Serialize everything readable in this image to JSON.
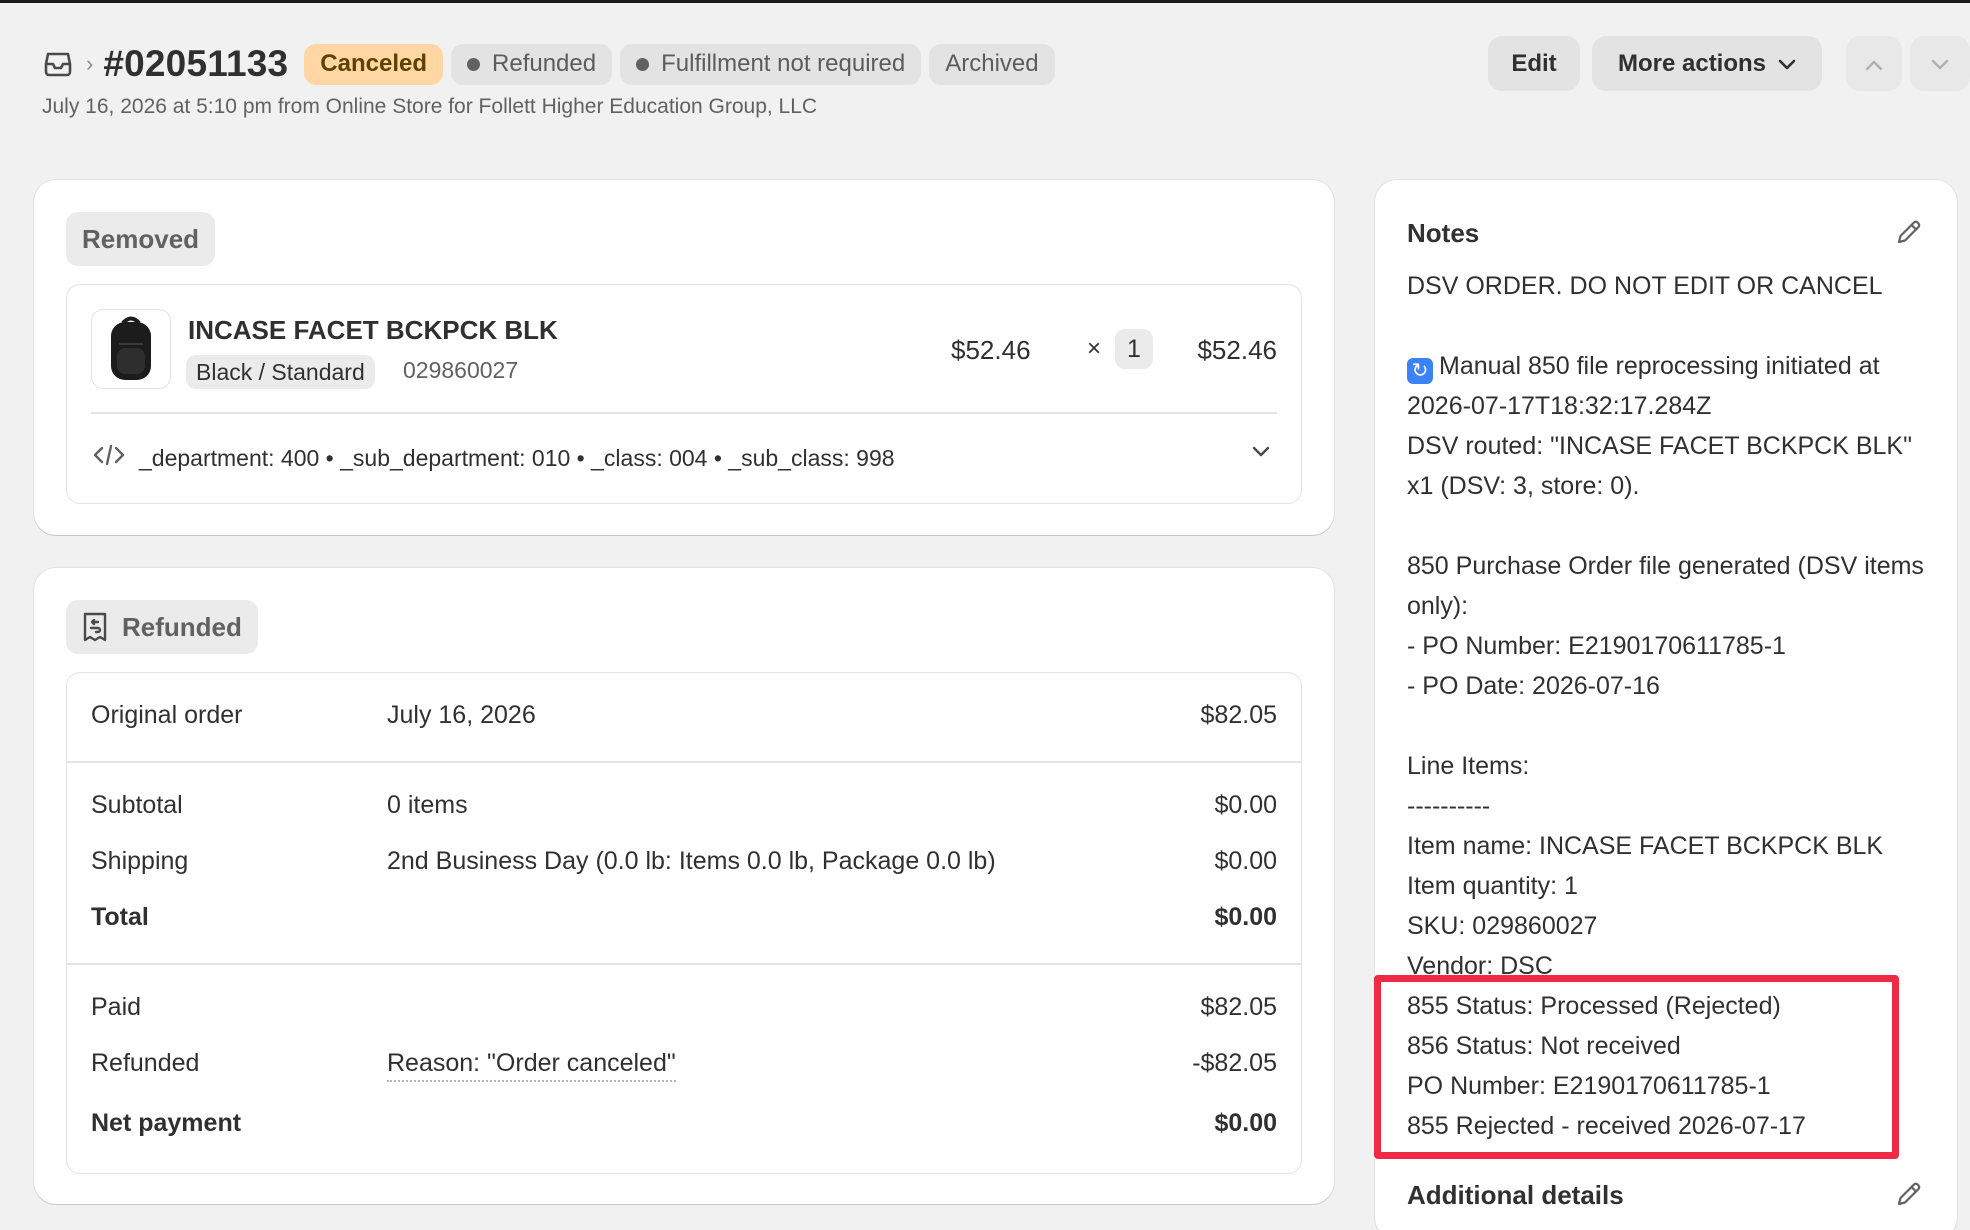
{
  "header": {
    "order_number": "#02051133",
    "badges": {
      "canceled": "Canceled",
      "refunded": "Refunded",
      "fulfillment": "Fulfillment not required",
      "archived": "Archived"
    },
    "subline": "July 16, 2026 at 5:10 pm from Online Store for Follett Higher Education Group, LLC",
    "edit_label": "Edit",
    "more_actions_label": "More actions"
  },
  "removed": {
    "label": "Removed",
    "product": {
      "name": "INCASE FACET BCKPCK BLK",
      "variant": "Black / Standard",
      "sku": "029860027",
      "unit_price": "$52.46",
      "times": "×",
      "quantity": "1",
      "total": "$52.46"
    },
    "attributes": "_department: 400 • _sub_department: 010 • _class: 004 • _sub_class: 998"
  },
  "refunded": {
    "label": "Refunded",
    "original_order": {
      "label": "Original order",
      "date": "July 16, 2026",
      "amount": "$82.05"
    },
    "subtotal": {
      "label": "Subtotal",
      "detail": "0 items",
      "amount": "$0.00"
    },
    "shipping": {
      "label": "Shipping",
      "detail": "2nd Business Day (0.0 lb: Items 0.0 lb, Package 0.0 lb)",
      "amount": "$0.00"
    },
    "total": {
      "label": "Total",
      "amount": "$0.00"
    },
    "paid": {
      "label": "Paid",
      "amount": "$82.05"
    },
    "refund": {
      "label": "Refunded",
      "reason": "Reason: \"Order canceled\"",
      "amount": "-$82.05"
    },
    "net_payment": {
      "label": "Net payment",
      "amount": "$0.00"
    }
  },
  "notes": {
    "title": "Notes",
    "lines": [
      "DSV ORDER. DO NOT EDIT OR CANCEL",
      "",
      "Manual 850 file reprocessing initiated at 2026-07-17T18:32:17.284Z",
      "DSV routed: \"INCASE FACET BCKPCK BLK\" x1 (DSV: 3, store: 0).",
      "",
      "850 Purchase Order file generated (DSV items only):",
      "- PO Number: E2190170611785-1",
      "- PO Date: 2026-07-16",
      "",
      "Line Items:",
      "----------",
      "Item name: INCASE FACET BCKPCK BLK",
      "Item quantity: 1",
      "SKU: 029860027",
      "Vendor: DSC",
      "855 Status: Processed (Rejected)",
      "856 Status: Not received",
      "PO Number: E2190170611785-1",
      "855 Rejected - received 2026-07-17"
    ],
    "additional_details_title": "Additional details"
  },
  "colors": {
    "canceled_badge_bg": "#ffd6a4",
    "highlight_box": "#ee2a45",
    "page_bg": "#f1f1f1"
  }
}
